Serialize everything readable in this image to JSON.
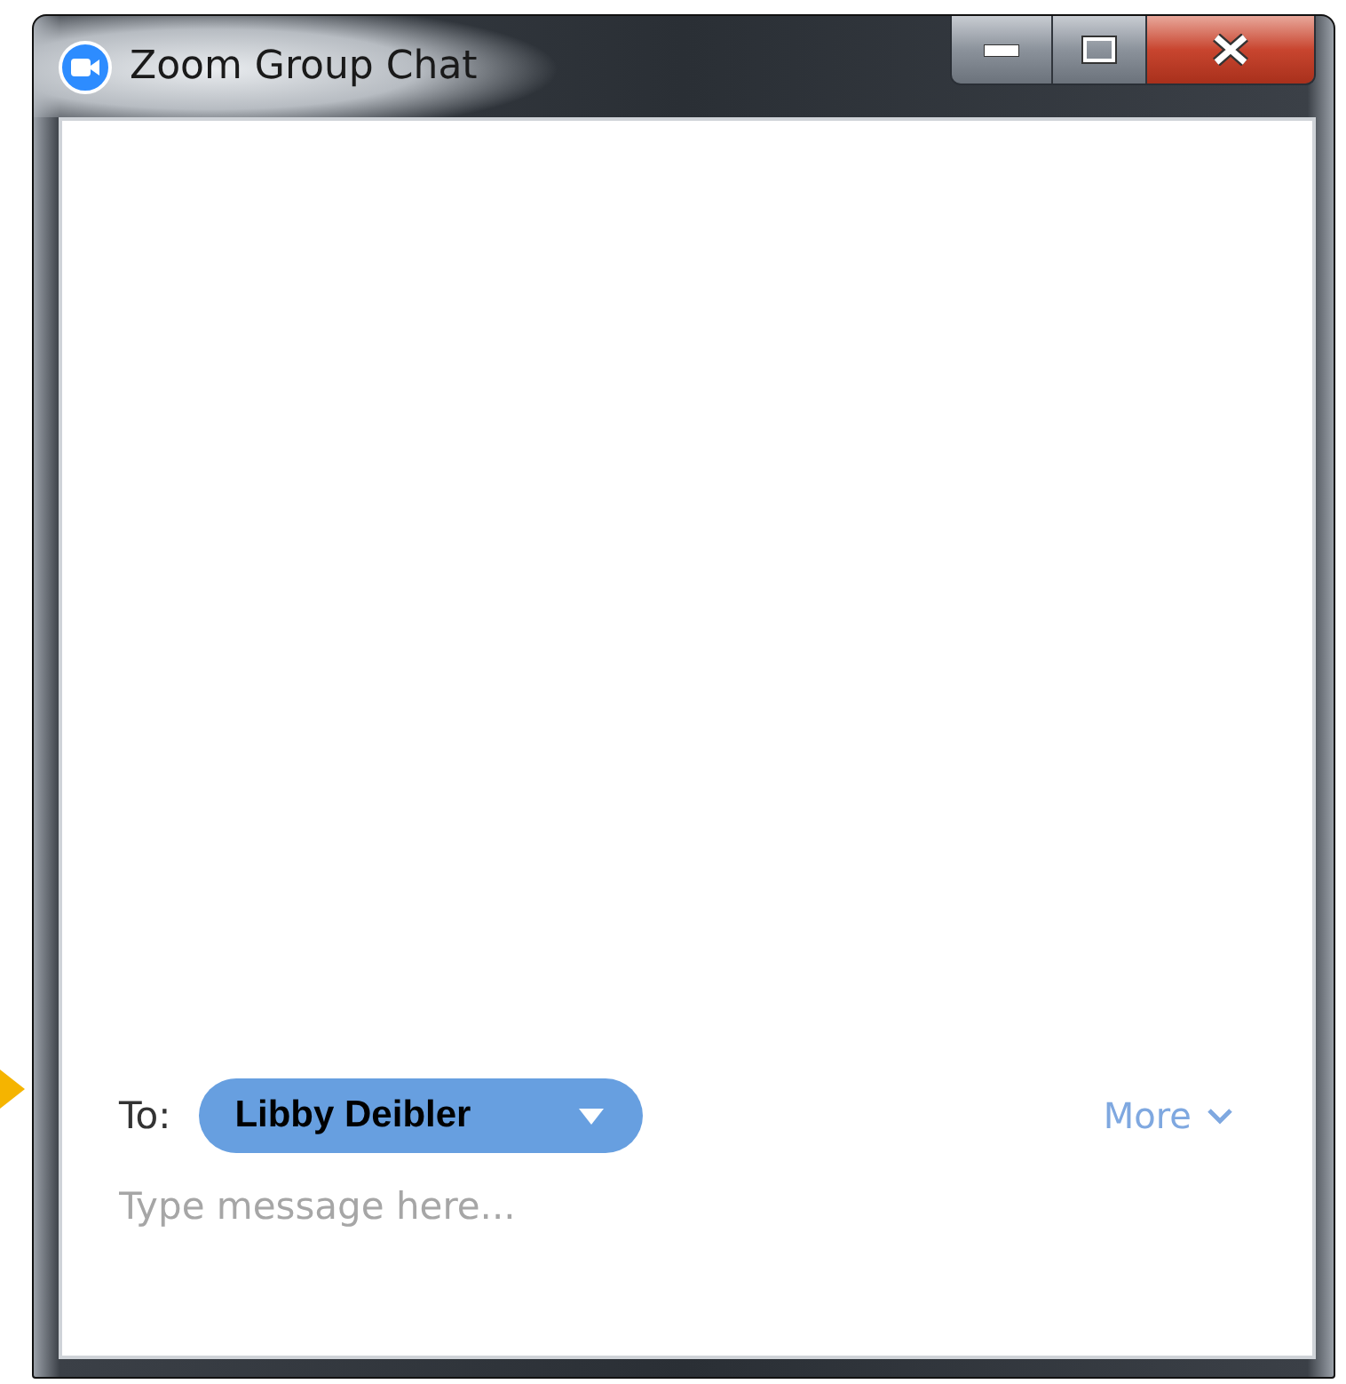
{
  "window": {
    "title": "Zoom Group Chat"
  },
  "composer": {
    "to_label": "To:",
    "recipient": "Libby Deibler",
    "more_link": "More",
    "message_field": {
      "placeholder": "Type message here..."
    }
  }
}
